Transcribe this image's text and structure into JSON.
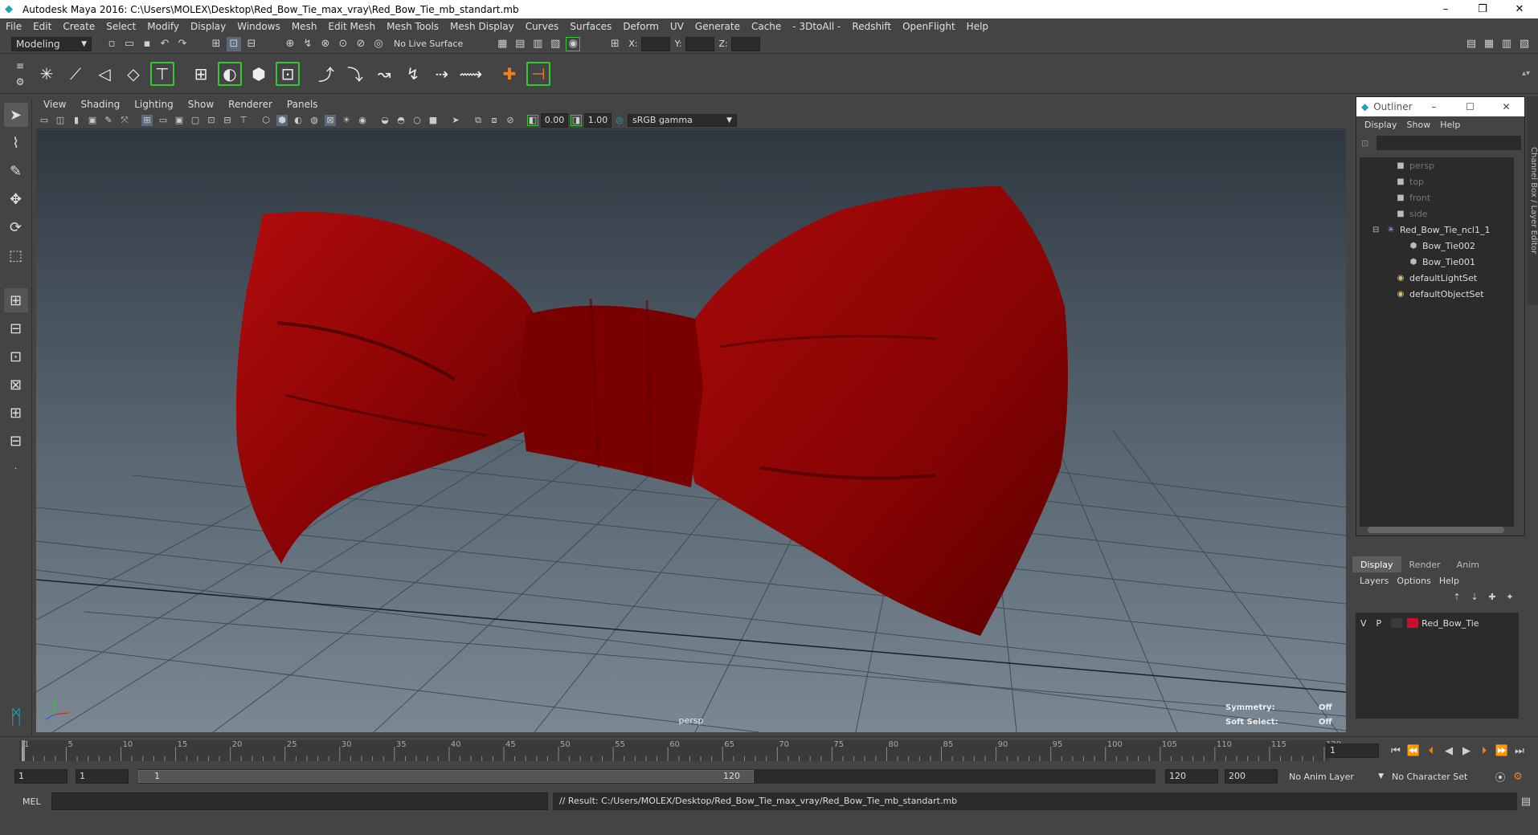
{
  "window": {
    "title": "Autodesk Maya 2016: C:\\Users\\MOLEX\\Desktop\\Red_Bow_Tie_max_vray\\Red_Bow_Tie_mb_standart.mb",
    "min": "–",
    "max": "❐",
    "close": "✕"
  },
  "menus": [
    "File",
    "Edit",
    "Create",
    "Select",
    "Modify",
    "Display",
    "Windows",
    "Mesh",
    "Edit Mesh",
    "Mesh Tools",
    "Mesh Display",
    "Curves",
    "Surfaces",
    "Deform",
    "UV",
    "Generate",
    "Cache",
    "- 3DtoAll -",
    "Redshift",
    "OpenFlight",
    "Help"
  ],
  "statusline": {
    "mode": "Modeling",
    "live_surface": "No Live Surface",
    "x_label": "X:",
    "y_label": "Y:",
    "z_label": "Z:"
  },
  "panel": {
    "menus": [
      "View",
      "Shading",
      "Lighting",
      "Show",
      "Renderer",
      "Panels"
    ],
    "exposure": "0.00",
    "gamma": "1.00",
    "color_space": "sRGB gamma"
  },
  "viewport": {
    "camera": "persp",
    "symmetry_label": "Symmetry:",
    "symmetry_value": "Off",
    "soft_select_label": "Soft Select:",
    "soft_select_value": "Off",
    "object_color": "#8b0000"
  },
  "outliner": {
    "title": "Outliner",
    "menus": [
      "Display",
      "Show",
      "Help"
    ],
    "items": [
      "persp",
      "top",
      "front",
      "side",
      "Red_Bow_Tie_ncl1_1",
      "Bow_Tie002",
      "Bow_Tie001",
      "defaultLightSet",
      "defaultObjectSet"
    ]
  },
  "layers": {
    "tabs": [
      "Display",
      "Render",
      "Anim"
    ],
    "menus": [
      "Layers",
      "Options",
      "Help"
    ],
    "layer": {
      "v": "V",
      "p": "P",
      "name": "Red_Bow_Tie",
      "color": "#c8102e"
    }
  },
  "timeline": {
    "ticks": [
      "1",
      "5",
      "10",
      "15",
      "20",
      "25",
      "30",
      "35",
      "40",
      "45",
      "50",
      "55",
      "60",
      "65",
      "70",
      "75",
      "80",
      "85",
      "90",
      "95",
      "100",
      "105",
      "110",
      "115",
      "120"
    ],
    "current_frame": "1"
  },
  "range": {
    "start": "1",
    "current": "1",
    "slider_start": "1",
    "slider_end": "120",
    "end": "120",
    "max": "200",
    "anim_layer": "No Anim Layer",
    "character_set": "No Character Set"
  },
  "command": {
    "lang": "MEL",
    "result": "// Result: C:/Users/MOLEX/Desktop/Red_Bow_Tie_max_vray/Red_Bow_Tie_mb_standart.mb"
  }
}
